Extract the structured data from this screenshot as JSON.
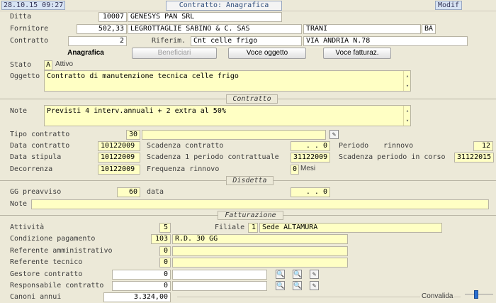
{
  "header": {
    "datetime": "28.10.15 09:27",
    "title": "Contratto: Anagrafica",
    "mode": "Modif"
  },
  "labels": {
    "ditta": "Ditta",
    "fornitore": "Fornitore",
    "contratto": "Contratto",
    "riferim": "Riferim.",
    "stato": "Stato",
    "oggetto": "Oggetto",
    "note": "Note",
    "tipo_contratto": "Tipo contratto",
    "data_contratto": "Data contratto",
    "scadenza_contratto": "Scadenza contratto",
    "periodo": "Periodo",
    "rinnovo": "rinnovo",
    "data_stipula": "Data stipula",
    "scadenza_1_periodo": "Scadenza 1 periodo contrattuale",
    "scadenza_periodo_corso": "Scadenza periodo in corso",
    "decorrenza": "Decorrenza",
    "frequenza_rinnovo": "Frequenza rinnovo",
    "mesi": "Mesi",
    "gg_preavviso": "GG preavviso",
    "data": "data",
    "note2": "Note",
    "attivita": "Attività",
    "filiale": "Filiale",
    "condizione_pagamento": "Condizione pagamento",
    "referente_amministrativo": "Referente amministrativo",
    "referente_tecnico": "Referente tecnico",
    "gestore_contratto": "Gestore contratto",
    "responsabile_contratto": "Responsabile contratto",
    "canoni_annui": "Canoni annui",
    "convalida": "Convalida"
  },
  "tabs": {
    "anagrafica": "Anagrafica",
    "beneficiari": "Beneficiari",
    "voce_oggetto": "Voce oggetto",
    "voce_fatturaz": "Voce fatturaz."
  },
  "sections": {
    "contratto": "Contratto",
    "disdetta": "Disdetta",
    "fatturazione": "Fatturazione"
  },
  "values": {
    "ditta_code": "10007",
    "ditta_name": "GENESYS PAN SRL",
    "fornitore_code": "502,33",
    "fornitore_name": "LEGROTTAGLIE SABINO & C. SAS",
    "fornitore_city": "TRANI",
    "fornitore_prov": "BA",
    "contratto_num": "2",
    "riferim_value": "Cnt celle frigo",
    "riferim_address": "VIA ANDRIA N.78",
    "stato_code": "A",
    "stato_desc": "Attivo",
    "oggetto_text": "Contratto di manutenzione tecnica celle frigo",
    "note_text": "Previsti 4 interv.annuali + 2 extra al 50%",
    "tipo_contratto_code": "30",
    "tipo_contratto_desc": "",
    "data_contratto": "10122009",
    "scadenza_contratto": ". .      0",
    "periodo_rinnovo": "12",
    "data_stipula": "10122009",
    "scadenza_1_periodo": "31122009",
    "scadenza_periodo_corso": "31122015",
    "decorrenza": "10122009",
    "frequenza_rinnovo": "0",
    "gg_preavviso": "60",
    "disdetta_data": ". .      0",
    "disdetta_note": "",
    "attivita": "5",
    "filiale_code": "1",
    "filiale_name": "Sede ALTAMURA",
    "condizione_pagamento_code": "103",
    "condizione_pagamento_desc": "R.D. 30 GG",
    "referente_amministrativo_code": "0",
    "referente_tecnico_code": "0",
    "gestore_contratto_code": "0",
    "responsabile_contratto_code": "0",
    "canoni_annui": "3.324,00"
  },
  "scroll": {
    "up": "▴",
    "down": "▾"
  },
  "icons": {
    "lookup": "🔍",
    "edit": "✎"
  },
  "colors": {
    "background": "#ece9d8",
    "field_yellow": "#ffffc4",
    "title_blue": "#2c4a78",
    "convalida_knob": "#2a6fd0"
  }
}
